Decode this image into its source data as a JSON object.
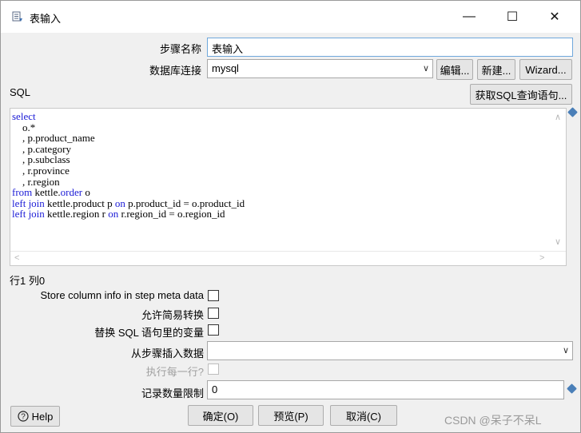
{
  "window": {
    "title": "表输入",
    "minimize_glyph": "—",
    "maximize_glyph": "☐",
    "close_glyph": "✕"
  },
  "step_name": {
    "label": "步骤名称",
    "value": "表输入"
  },
  "db_connection": {
    "label": "数据库连接",
    "value": "mysql",
    "edit_label": "编辑...",
    "new_label": "新建...",
    "wizard_label": "Wizard..."
  },
  "sql": {
    "label": "SQL",
    "get_query_label": "获取SQL查询语句...",
    "lines": [
      [
        {
          "t": "select",
          "kw": true
        }
      ],
      [
        {
          "t": "    o.*",
          "kw": false
        }
      ],
      [
        {
          "t": "    , p.product_name",
          "kw": false
        }
      ],
      [
        {
          "t": "    , p.category",
          "kw": false
        }
      ],
      [
        {
          "t": "    , p.subclass",
          "kw": false
        }
      ],
      [
        {
          "t": "    , r.province",
          "kw": false
        }
      ],
      [
        {
          "t": "    , r.region",
          "kw": false
        }
      ],
      [
        {
          "t": "from",
          "kw": true
        },
        {
          "t": " kettle.",
          "kw": false
        },
        {
          "t": "order",
          "kw": true
        },
        {
          "t": " o",
          "kw": false
        }
      ],
      [
        {
          "t": "left join",
          "kw": true
        },
        {
          "t": " kettle.product p ",
          "kw": false
        },
        {
          "t": "on",
          "kw": true
        },
        {
          "t": " p.product_id = o.product_id",
          "kw": false
        }
      ],
      [
        {
          "t": "left join",
          "kw": true
        },
        {
          "t": " kettle.region r ",
          "kw": false
        },
        {
          "t": "on",
          "kw": true
        },
        {
          "t": " r.region_id = o.region_id",
          "kw": false
        }
      ]
    ]
  },
  "cursor_position": "行1 列0",
  "options": {
    "store_column_info_label": "Store column info in step meta data",
    "lazy_conversion_label": "允许简易转换",
    "replace_variables_label": "替换 SQL 语句里的变量",
    "insert_from_step_label": "从步骤插入数据",
    "insert_from_step_value": "",
    "execute_each_row_label": "执行每一行?",
    "limit_label": "记录数量限制",
    "limit_value": "0"
  },
  "footer": {
    "help_label": "Help",
    "ok_label": "确定(O)",
    "preview_label": "预览(P)",
    "cancel_label": "取消(C)"
  },
  "watermark": "CSDN @呆子不呆L"
}
